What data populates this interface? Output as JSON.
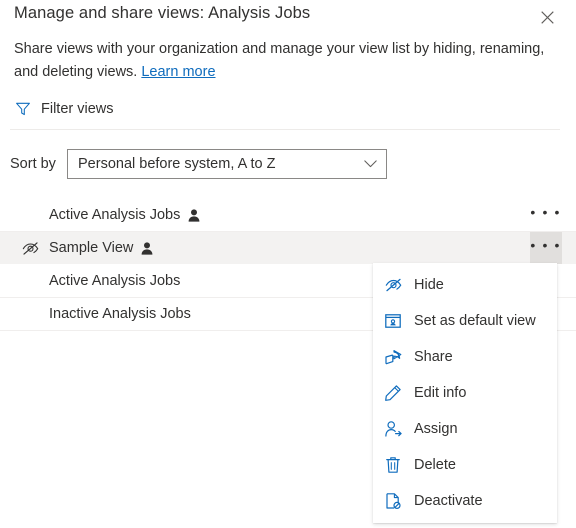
{
  "header": {
    "title": "Manage and share views: Analysis Jobs",
    "close_icon": "close-icon"
  },
  "description": {
    "text": "Share views with your organization and manage your view list by hiding, renaming, and deleting views.",
    "link_label": "Learn more"
  },
  "filter": {
    "label": "Filter views",
    "icon": "filter-icon",
    "icon_color": "#0f6cbd"
  },
  "sort": {
    "label": "Sort by",
    "value": "Personal before system, A to Z",
    "chevron_icon": "chevron-down-icon"
  },
  "views": [
    {
      "name": "Active Analysis Jobs",
      "hidden": false,
      "personal": true,
      "selected": false,
      "more_label": "• • •"
    },
    {
      "name": "Sample View",
      "hidden": true,
      "personal": true,
      "selected": true,
      "more_label": "• • •"
    },
    {
      "name": "Active Analysis Jobs",
      "hidden": false,
      "personal": false,
      "selected": false,
      "more_label": "• • •"
    },
    {
      "name": "Inactive Analysis Jobs",
      "hidden": false,
      "personal": false,
      "selected": false,
      "more_label": "• • •"
    }
  ],
  "context_menu": {
    "items": [
      {
        "label": "Hide",
        "icon": "hide-eye-icon"
      },
      {
        "label": "Set as default view",
        "icon": "default-view-icon"
      },
      {
        "label": "Share",
        "icon": "share-icon"
      },
      {
        "label": "Edit info",
        "icon": "pencil-edit-icon"
      },
      {
        "label": "Assign",
        "icon": "assign-person-icon"
      },
      {
        "label": "Delete",
        "icon": "trash-delete-icon"
      },
      {
        "label": "Deactivate",
        "icon": "deactivate-document-icon"
      }
    ]
  },
  "colors": {
    "accent": "#0f6cbd",
    "text": "#323130",
    "row_selected_bg": "#f3f2f1",
    "divider": "#edebe9"
  }
}
